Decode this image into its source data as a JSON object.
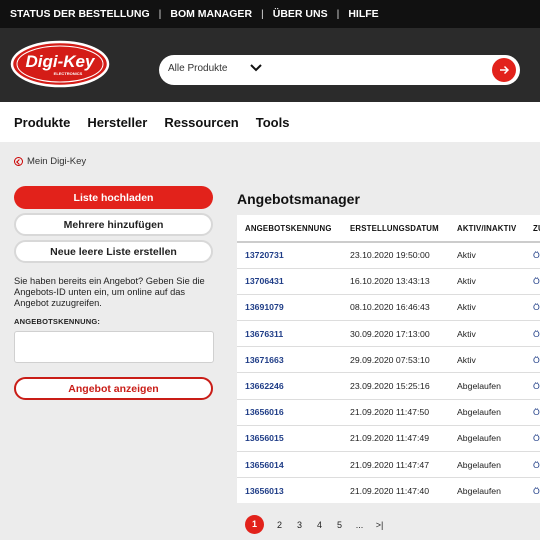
{
  "topbar": {
    "items": [
      "STATUS DER BESTELLUNG",
      "BOM MANAGER",
      "ÜBER UNS",
      "HILFE"
    ],
    "separator": "|"
  },
  "brand": {
    "logo_text": "Digi-Key",
    "logo_subtext": "ELECTRONICS",
    "accent_color": "#e2221b"
  },
  "search": {
    "category": "Alle Produkte",
    "placeholder": "",
    "icons": {
      "dropdown": "chevron-down-icon",
      "submit": "arrow-right-icon"
    }
  },
  "nav": {
    "items": [
      "Produkte",
      "Hersteller",
      "Ressourcen",
      "Tools"
    ]
  },
  "breadcrumb": {
    "label": "Mein Digi-Key"
  },
  "left": {
    "upload_label": "Liste hochladen",
    "add_multiple_label": "Mehrere hinzufügen",
    "new_list_label": "Neue leere Liste erstellen",
    "info_text": "Sie haben bereits ein Angebot? Geben Sie die Angebots-ID unten ein, um online auf das Angebot zuzugreifen.",
    "field_label": "ANGEBOTSKENNUNG:",
    "field_value": "",
    "show_label": "Angebot anzeigen"
  },
  "quotes": {
    "title": "Angebotsmanager",
    "columns": [
      "ANGEBOTSKENNUNG",
      "ERSTELLUNGSDATUM",
      "AKTIV/INAKTIV",
      "ZU"
    ],
    "rows": [
      [
        "13720731",
        "23.10.2020 19:50:00",
        "Aktiv",
        "Ö"
      ],
      [
        "13706431",
        "16.10.2020 13:43:13",
        "Aktiv",
        "Ö"
      ],
      [
        "13691079",
        "08.10.2020 16:46:43",
        "Aktiv",
        "Ö"
      ],
      [
        "13676311",
        "30.09.2020 17:13:00",
        "Aktiv",
        "Ö"
      ],
      [
        "13671663",
        "29.09.2020 07:53:10",
        "Aktiv",
        "Ö"
      ],
      [
        "13662246",
        "23.09.2020 15:25:16",
        "Abgelaufen",
        "Ö"
      ],
      [
        "13656016",
        "21.09.2020 11:47:50",
        "Abgelaufen",
        "Ö"
      ],
      [
        "13656015",
        "21.09.2020 11:47:49",
        "Abgelaufen",
        "Ö"
      ],
      [
        "13656014",
        "21.09.2020 11:47:47",
        "Abgelaufen",
        "Ö"
      ],
      [
        "13656013",
        "21.09.2020 11:47:40",
        "Abgelaufen",
        "Ö"
      ]
    ]
  },
  "pagination": {
    "pages": [
      "1",
      "2",
      "3",
      "4",
      "5",
      "...",
      ">|"
    ],
    "current": "1"
  }
}
